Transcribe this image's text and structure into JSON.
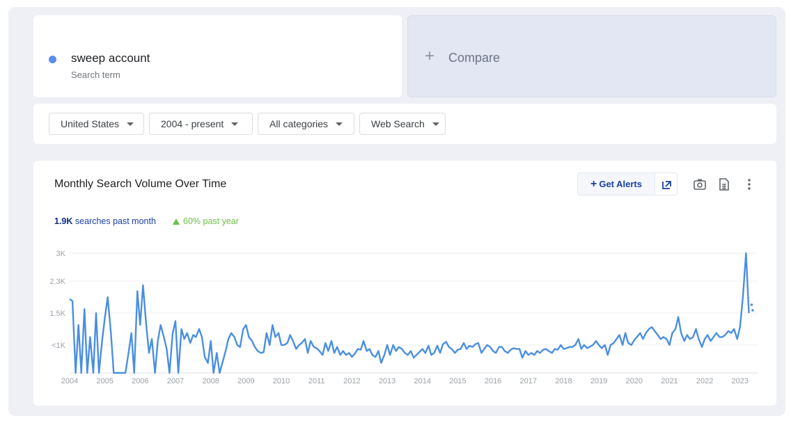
{
  "search_term": {
    "name": "sweep account",
    "subtitle": "Search term",
    "dot_color": "#5b8def"
  },
  "compare": {
    "plus": "+",
    "label": "Compare"
  },
  "filters": [
    {
      "label": "United States"
    },
    {
      "label": "2004 - present"
    },
    {
      "label": "All categories"
    },
    {
      "label": "Web Search"
    }
  ],
  "chart_header": {
    "title": "Monthly Search Volume Over Time",
    "alerts_label": "Get Alerts",
    "icons": [
      "external-link-icon",
      "camera-icon",
      "spreadsheet-icon",
      "more-vert-icon"
    ]
  },
  "stats": {
    "month_value": "1.9K",
    "month_text": "searches past month",
    "year_text": "60% past year",
    "year_color": "#6cc04a"
  },
  "chart_data": {
    "type": "line",
    "title": "",
    "xlabel": "",
    "ylabel": "",
    "x_ticks": [
      "2004",
      "2005",
      "2006",
      "2007",
      "2008",
      "2009",
      "2010",
      "2011",
      "2012",
      "2013",
      "2014",
      "2015",
      "2016",
      "2017",
      "2018",
      "2019",
      "2020",
      "2021",
      "2022",
      "2023"
    ],
    "y_ticks": [
      {
        "label": "<1K",
        "value": 700
      },
      {
        "label": "1.5K",
        "value": 1500
      },
      {
        "label": "2.3K",
        "value": 2300
      },
      {
        "label": "3K",
        "value": 3000
      }
    ],
    "xlim": [
      2004.0,
      2023.3
    ],
    "ylim": [
      0,
      3000
    ],
    "grid": true,
    "line_color": "#4a8fe0",
    "series": [
      {
        "values": [
          [
            2004.0,
            1850
          ],
          [
            2004.08,
            1800
          ],
          [
            2004.17,
            0
          ],
          [
            2004.25,
            1200
          ],
          [
            2004.33,
            0
          ],
          [
            2004.42,
            1600
          ],
          [
            2004.5,
            0
          ],
          [
            2004.58,
            900
          ],
          [
            2004.67,
            0
          ],
          [
            2004.75,
            1500
          ],
          [
            2004.83,
            0
          ],
          [
            2004.92,
            800
          ],
          [
            2005.0,
            1400
          ],
          [
            2005.08,
            1900
          ],
          [
            2005.17,
            1000
          ],
          [
            2005.25,
            0
          ],
          [
            2005.33,
            0
          ],
          [
            2005.42,
            0
          ],
          [
            2005.5,
            0
          ],
          [
            2005.58,
            0
          ],
          [
            2005.67,
            500
          ],
          [
            2005.75,
            1000
          ],
          [
            2005.83,
            0
          ],
          [
            2005.92,
            2050
          ],
          [
            2006.0,
            1200
          ],
          [
            2006.08,
            2200
          ],
          [
            2006.17,
            1200
          ],
          [
            2006.25,
            500
          ],
          [
            2006.33,
            850
          ],
          [
            2006.42,
            0
          ],
          [
            2006.5,
            800
          ],
          [
            2006.58,
            1200
          ],
          [
            2006.67,
            900
          ],
          [
            2006.75,
            600
          ],
          [
            2006.83,
            0
          ],
          [
            2006.92,
            1000
          ],
          [
            2007.0,
            1300
          ],
          [
            2007.08,
            0
          ],
          [
            2007.17,
            1100
          ],
          [
            2007.25,
            850
          ],
          [
            2007.33,
            1000
          ],
          [
            2007.42,
            750
          ],
          [
            2007.5,
            950
          ],
          [
            2007.58,
            900
          ],
          [
            2007.67,
            1100
          ],
          [
            2007.75,
            900
          ],
          [
            2007.83,
            400
          ],
          [
            2007.92,
            250
          ],
          [
            2008.0,
            800
          ],
          [
            2008.08,
            0
          ],
          [
            2008.17,
            500
          ],
          [
            2008.25,
            0
          ],
          [
            2008.33,
            250
          ],
          [
            2008.42,
            550
          ],
          [
            2008.5,
            850
          ],
          [
            2008.58,
            1000
          ],
          [
            2008.67,
            900
          ],
          [
            2008.75,
            700
          ],
          [
            2008.83,
            650
          ],
          [
            2008.92,
            1100
          ],
          [
            2009.0,
            1200
          ],
          [
            2009.08,
            900
          ],
          [
            2009.17,
            800
          ],
          [
            2009.25,
            650
          ],
          [
            2009.33,
            550
          ],
          [
            2009.42,
            500
          ],
          [
            2009.5,
            520
          ],
          [
            2009.58,
            1000
          ],
          [
            2009.67,
            700
          ],
          [
            2009.75,
            1200
          ],
          [
            2009.83,
            900
          ],
          [
            2009.92,
            1000
          ],
          [
            2010.0,
            700
          ],
          [
            2010.08,
            700
          ],
          [
            2010.17,
            750
          ],
          [
            2010.25,
            950
          ],
          [
            2010.33,
            800
          ],
          [
            2010.42,
            600
          ],
          [
            2010.5,
            700
          ],
          [
            2010.58,
            750
          ],
          [
            2010.67,
            850
          ],
          [
            2010.75,
            500
          ],
          [
            2010.83,
            800
          ],
          [
            2010.92,
            650
          ],
          [
            2011.0,
            620
          ],
          [
            2011.08,
            550
          ],
          [
            2011.17,
            450
          ],
          [
            2011.25,
            750
          ],
          [
            2011.33,
            550
          ],
          [
            2011.42,
            800
          ],
          [
            2011.5,
            500
          ],
          [
            2011.58,
            650
          ],
          [
            2011.67,
            450
          ],
          [
            2011.75,
            550
          ],
          [
            2011.83,
            450
          ],
          [
            2011.92,
            500
          ],
          [
            2012.0,
            400
          ],
          [
            2012.08,
            480
          ],
          [
            2012.17,
            600
          ],
          [
            2012.25,
            580
          ],
          [
            2012.33,
            800
          ],
          [
            2012.42,
            550
          ],
          [
            2012.5,
            600
          ],
          [
            2012.58,
            450
          ],
          [
            2012.67,
            400
          ],
          [
            2012.75,
            550
          ],
          [
            2012.83,
            250
          ],
          [
            2012.92,
            450
          ],
          [
            2013.0,
            700
          ],
          [
            2013.08,
            450
          ],
          [
            2013.17,
            700
          ],
          [
            2013.25,
            550
          ],
          [
            2013.33,
            650
          ],
          [
            2013.42,
            600
          ],
          [
            2013.5,
            500
          ],
          [
            2013.58,
            450
          ],
          [
            2013.67,
            550
          ],
          [
            2013.75,
            380
          ],
          [
            2013.83,
            450
          ],
          [
            2013.92,
            530
          ],
          [
            2014.0,
            600
          ],
          [
            2014.08,
            500
          ],
          [
            2014.17,
            680
          ],
          [
            2014.25,
            450
          ],
          [
            2014.33,
            500
          ],
          [
            2014.42,
            680
          ],
          [
            2014.5,
            500
          ],
          [
            2014.58,
            720
          ],
          [
            2014.67,
            780
          ],
          [
            2014.75,
            650
          ],
          [
            2014.83,
            600
          ],
          [
            2014.92,
            500
          ],
          [
            2015.0,
            580
          ],
          [
            2015.08,
            600
          ],
          [
            2015.17,
            750
          ],
          [
            2015.25,
            600
          ],
          [
            2015.33,
            680
          ],
          [
            2015.42,
            650
          ],
          [
            2015.5,
            720
          ],
          [
            2015.58,
            750
          ],
          [
            2015.67,
            500
          ],
          [
            2015.75,
            600
          ],
          [
            2015.83,
            700
          ],
          [
            2015.92,
            650
          ],
          [
            2016.0,
            550
          ],
          [
            2016.08,
            500
          ],
          [
            2016.17,
            650
          ],
          [
            2016.25,
            650
          ],
          [
            2016.33,
            550
          ],
          [
            2016.42,
            500
          ],
          [
            2016.5,
            580
          ],
          [
            2016.58,
            620
          ],
          [
            2016.67,
            600
          ],
          [
            2016.75,
            600
          ],
          [
            2016.83,
            380
          ],
          [
            2016.92,
            550
          ],
          [
            2017.0,
            450
          ],
          [
            2017.08,
            500
          ],
          [
            2017.17,
            450
          ],
          [
            2017.25,
            550
          ],
          [
            2017.33,
            500
          ],
          [
            2017.42,
            580
          ],
          [
            2017.5,
            600
          ],
          [
            2017.58,
            550
          ],
          [
            2017.67,
            500
          ],
          [
            2017.75,
            600
          ],
          [
            2017.83,
            580
          ],
          [
            2017.92,
            700
          ],
          [
            2018.0,
            600
          ],
          [
            2018.08,
            620
          ],
          [
            2018.17,
            650
          ],
          [
            2018.25,
            650
          ],
          [
            2018.33,
            700
          ],
          [
            2018.42,
            850
          ],
          [
            2018.5,
            600
          ],
          [
            2018.58,
            700
          ],
          [
            2018.67,
            620
          ],
          [
            2018.75,
            660
          ],
          [
            2018.83,
            700
          ],
          [
            2018.92,
            800
          ],
          [
            2019.0,
            700
          ],
          [
            2019.08,
            620
          ],
          [
            2019.17,
            700
          ],
          [
            2019.25,
            450
          ],
          [
            2019.33,
            700
          ],
          [
            2019.42,
            750
          ],
          [
            2019.5,
            850
          ],
          [
            2019.58,
            950
          ],
          [
            2019.67,
            700
          ],
          [
            2019.75,
            1000
          ],
          [
            2019.83,
            750
          ],
          [
            2019.92,
            700
          ],
          [
            2020.0,
            820
          ],
          [
            2020.08,
            900
          ],
          [
            2020.17,
            1000
          ],
          [
            2020.25,
            850
          ],
          [
            2020.33,
            1000
          ],
          [
            2020.42,
            1100
          ],
          [
            2020.5,
            1150
          ],
          [
            2020.58,
            1050
          ],
          [
            2020.67,
            950
          ],
          [
            2020.75,
            850
          ],
          [
            2020.83,
            900
          ],
          [
            2020.92,
            850
          ],
          [
            2021.0,
            700
          ],
          [
            2021.08,
            1000
          ],
          [
            2021.17,
            1100
          ],
          [
            2021.25,
            1400
          ],
          [
            2021.33,
            1000
          ],
          [
            2021.42,
            800
          ],
          [
            2021.5,
            950
          ],
          [
            2021.58,
            850
          ],
          [
            2021.67,
            900
          ],
          [
            2021.75,
            1100
          ],
          [
            2021.83,
            850
          ],
          [
            2021.92,
            650
          ],
          [
            2022.0,
            850
          ],
          [
            2022.08,
            950
          ],
          [
            2022.17,
            800
          ],
          [
            2022.25,
            900
          ],
          [
            2022.33,
            1000
          ],
          [
            2022.42,
            900
          ],
          [
            2022.5,
            900
          ],
          [
            2022.58,
            950
          ],
          [
            2022.67,
            1050
          ],
          [
            2022.75,
            1000
          ],
          [
            2022.83,
            1100
          ],
          [
            2022.92,
            850
          ],
          [
            2023.0,
            1150
          ],
          [
            2023.08,
            1900
          ],
          [
            2023.17,
            3000
          ],
          [
            2023.25,
            1500
          ]
        ]
      }
    ]
  }
}
